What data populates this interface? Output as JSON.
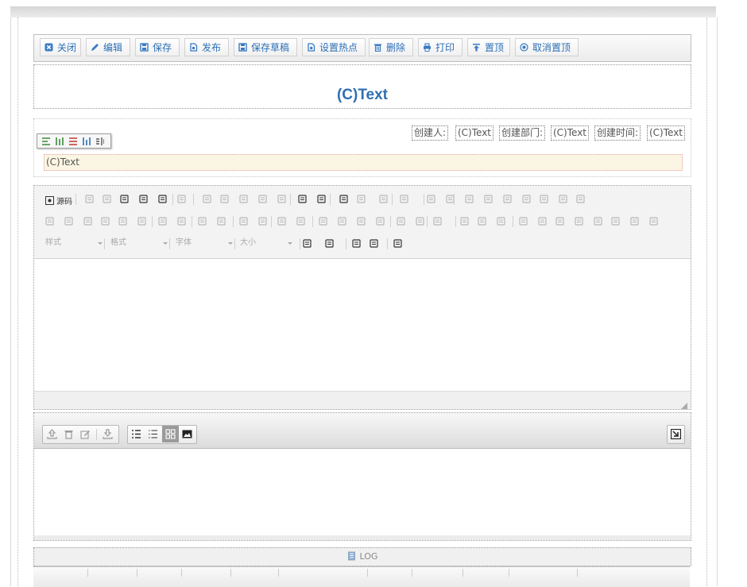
{
  "toolbar": {
    "buttons": [
      {
        "label": "关闭",
        "icon": "close-icon"
      },
      {
        "label": "编辑",
        "icon": "pencil-icon"
      },
      {
        "label": "保存",
        "icon": "save-icon"
      },
      {
        "label": "发布",
        "icon": "publish-icon"
      },
      {
        "label": "保存草稿",
        "icon": "save-draft-icon"
      },
      {
        "label": "设置热点",
        "icon": "hotspot-icon"
      },
      {
        "label": "删除",
        "icon": "trash-icon"
      },
      {
        "label": "打印",
        "icon": "print-icon"
      },
      {
        "label": "置顶",
        "icon": "pin-top-icon"
      },
      {
        "label": "取消置顶",
        "icon": "unpin-icon"
      }
    ]
  },
  "document": {
    "title": "(C)Text",
    "meta": {
      "creator_label": "创建人:",
      "creator_value": "(C)Text",
      "dept_label": "创建部门:",
      "dept_value": "(C)Text",
      "time_label": "创建时间:",
      "time_value": "(C)Text"
    },
    "text_field": "(C)Text"
  },
  "editor": {
    "source_label": "源码",
    "combos": {
      "style": "样式",
      "format": "格式",
      "font": "字体",
      "size": "大小"
    }
  },
  "log": {
    "label": "LOG"
  },
  "colors": {
    "accent": "#2b6fb6",
    "title": "#2f6fb0",
    "field_bg": "#fbf6e3"
  }
}
